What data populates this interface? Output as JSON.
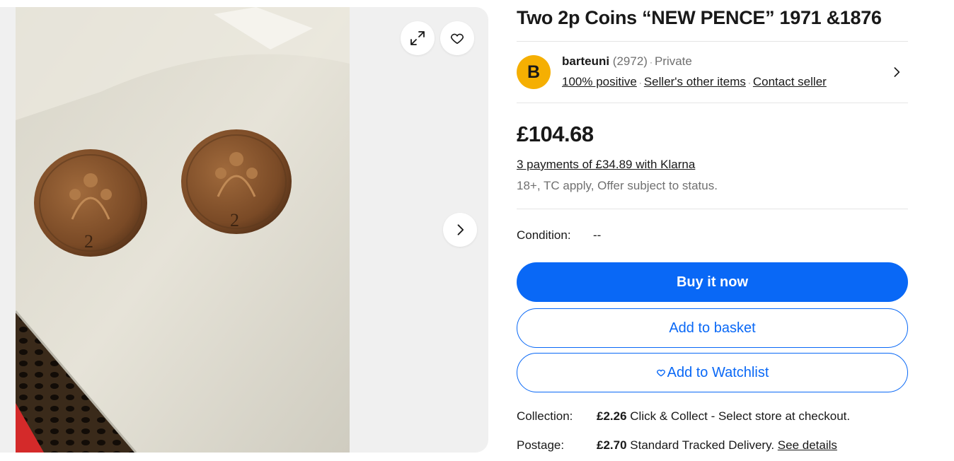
{
  "gallery": {
    "image_alt": "Two 2p coins on a white painted ledge",
    "icons": {
      "expand": "expand-icon",
      "watch": "heart-icon",
      "next": "chevron-right-icon"
    }
  },
  "listing": {
    "title": "Two 2p Coins “NEW PENCE” 1971 &1876"
  },
  "seller": {
    "avatar_letter": "B",
    "name": "barteuni",
    "feedback_count": "(2972)",
    "type": "Private",
    "feedback": "100% positive",
    "other_items": "Seller's other items",
    "contact": "Contact seller"
  },
  "pricing": {
    "price": "£104.68",
    "klarna": "3 payments of £34.89 with Klarna",
    "klarna_note": "18+, TC apply, Offer subject to status."
  },
  "condition": {
    "label": "Condition:",
    "value": "--"
  },
  "actions": {
    "buy_now": "Buy it now",
    "add_to_basket": "Add to basket",
    "add_to_watchlist": "Add to Watchlist"
  },
  "delivery": {
    "collection_label": "Collection:",
    "collection_price": "£2.26",
    "collection_text": "Click & Collect - Select store at checkout.",
    "postage_label": "Postage:",
    "postage_price": "£2.70",
    "postage_text": "Standard Tracked Delivery.",
    "postage_link": "See details"
  },
  "colors": {
    "primary": "#0968f6",
    "avatar": "#f5af02",
    "muted": "#707070"
  }
}
